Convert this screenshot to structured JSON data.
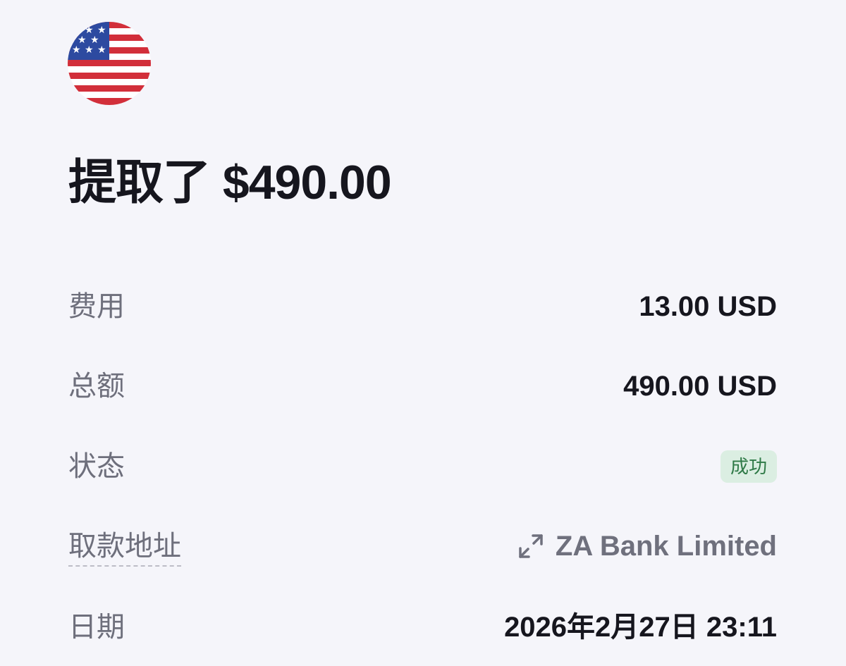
{
  "header": {
    "flag_icon": "us-flag-icon",
    "title": "提取了 $490.00"
  },
  "details": {
    "fee_label": "费用",
    "fee_value": "13.00 USD",
    "total_label": "总额",
    "total_value": "490.00 USD",
    "status_label": "状态",
    "status_value": "成功",
    "status_color": "#2f7a47",
    "address_label": "取款地址",
    "address_value": "ZA Bank Limited",
    "address_icon": "expand-icon",
    "date_label": "日期",
    "date_value": "2026年2月27日 23:11"
  }
}
